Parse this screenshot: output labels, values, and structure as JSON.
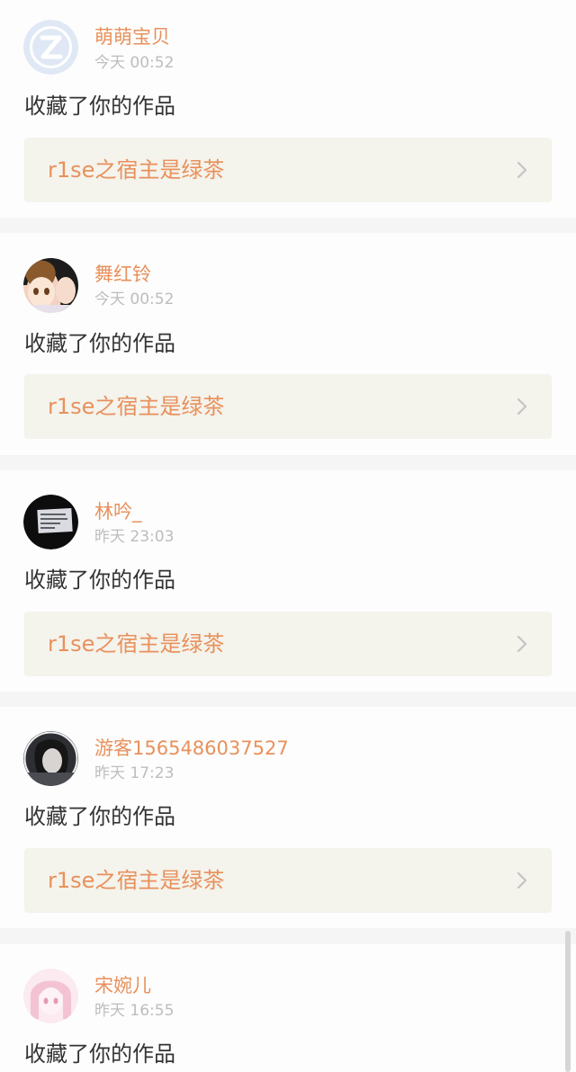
{
  "colors": {
    "accent": "#e8915c",
    "divider": "#f5f5f5",
    "card_bg": "#fdfdfd",
    "link_bg": "#f4f3ec",
    "time": "#bdbdbd",
    "text": "#333333"
  },
  "notifications": [
    {
      "username": "萌萌宝贝",
      "time": "今天 00:52",
      "action": "收藏了你的作品",
      "work_title": "r1se之宿主是绿茶",
      "avatar": "default-avatar-icon"
    },
    {
      "username": "舞红铃",
      "time": "今天 00:52",
      "action": "收藏了你的作品",
      "work_title": "r1se之宿主是绿茶",
      "avatar": "anime-two-girls-avatar"
    },
    {
      "username": "林吟_",
      "time": "昨天 23:03",
      "action": "收藏了你的作品",
      "work_title": "r1se之宿主是绿茶",
      "avatar": "dark-phone-avatar"
    },
    {
      "username": "游客1565486037527",
      "time": "昨天 17:23",
      "action": "收藏了你的作品",
      "work_title": "r1se之宿主是绿茶",
      "avatar": "girl-portrait-avatar"
    },
    {
      "username": "宋婉儿",
      "time": "昨天 16:55",
      "action": "收藏了你的作品",
      "work_title": "",
      "avatar": "pink-anime-girl-avatar"
    }
  ]
}
